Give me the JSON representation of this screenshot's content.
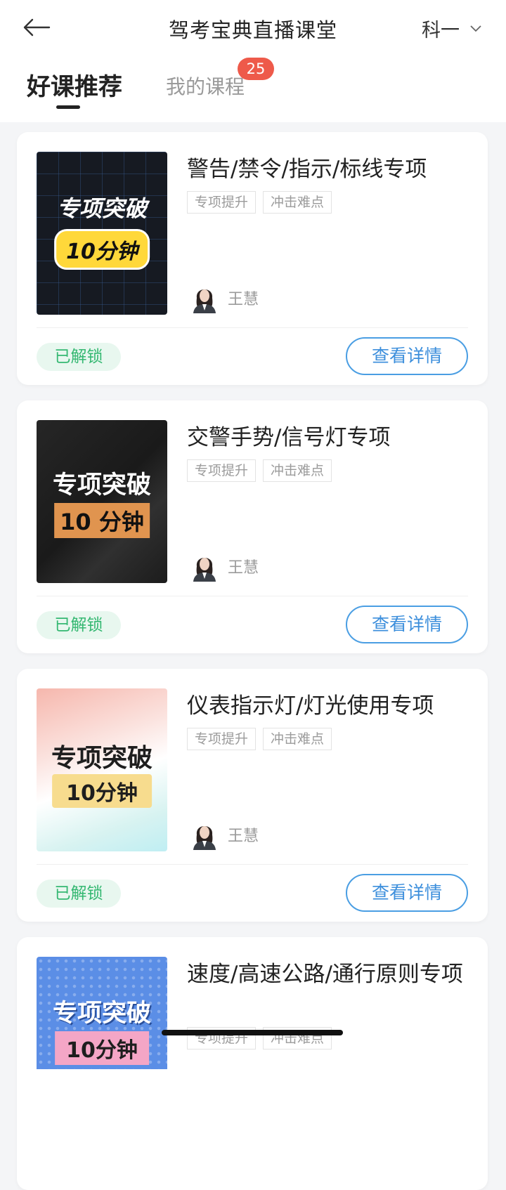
{
  "header": {
    "title": "驾考宝典直播课堂",
    "subject": "科一"
  },
  "tabs": {
    "recommended": "好课推荐",
    "my_courses": "我的课程",
    "my_courses_badge": "25"
  },
  "courses": [
    {
      "title": "警告/禁令/指示/标线专项",
      "thumb_line1": "专项突破",
      "thumb_line2": "10分钟",
      "tags": [
        "专项提升",
        "冲击难点"
      ],
      "teacher": "王慧",
      "status": "已解锁",
      "button": "查看详情"
    },
    {
      "title": "交警手势/信号灯专项",
      "thumb_line1": "专项突破",
      "thumb_line2": "10 分钟",
      "tags": [
        "专项提升",
        "冲击难点"
      ],
      "teacher": "王慧",
      "status": "已解锁",
      "button": "查看详情"
    },
    {
      "title": "仪表指示灯/灯光使用专项",
      "thumb_line1": "专项突破",
      "thumb_line2": "10分钟",
      "tags": [
        "专项提升",
        "冲击难点"
      ],
      "teacher": "王慧",
      "status": "已解锁",
      "button": "查看详情"
    },
    {
      "title": "速度/高速公路/通行原则专项",
      "thumb_line1": "专项突破",
      "thumb_line2": "10分钟",
      "tags": [
        "专项提升",
        "冲击难点"
      ],
      "teacher": "",
      "status": "",
      "button": ""
    }
  ],
  "colors": {
    "accent_blue": "#3d8fdc",
    "unlocked_green": "#35b872",
    "badge_red": "#ee5a4a"
  }
}
